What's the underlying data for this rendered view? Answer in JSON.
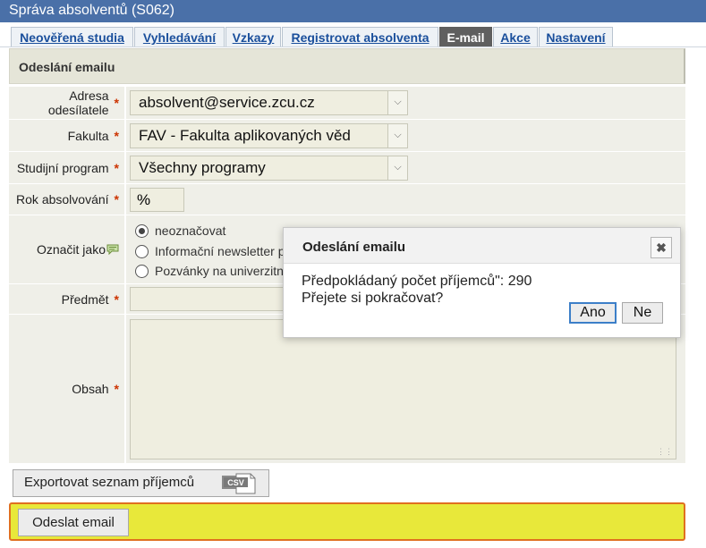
{
  "window": {
    "title": "Správa absolventů (S062)"
  },
  "tabs": [
    {
      "label": "Neověřená studia",
      "active": false
    },
    {
      "label": "Vyhledávání",
      "active": false
    },
    {
      "label": "Vzkazy",
      "active": false
    },
    {
      "label": "Registrovat absolventa",
      "active": false
    },
    {
      "label": "E-mail",
      "active": true
    },
    {
      "label": "Akce",
      "active": false
    },
    {
      "label": "Nastavení",
      "active": false
    }
  ],
  "section": {
    "title": "Odeslání emailu"
  },
  "form": {
    "required_mark": "*",
    "sender": {
      "label": "Adresa odesílatele",
      "value": "absolvent@service.zcu.cz"
    },
    "faculty": {
      "label": "Fakulta",
      "value": "FAV - Fakulta aplikovaných věd"
    },
    "program": {
      "label": "Studijní program",
      "value": "Všechny programy"
    },
    "year": {
      "label": "Rok absolvování",
      "value": "%"
    },
    "mark_as": {
      "label": "Označit jako",
      "options": [
        "neoznačovat",
        "Informační newsletter p",
        "Pozvánky na univerzitn"
      ],
      "selected": 0
    },
    "subject": {
      "label": "Předmět",
      "value": ""
    },
    "body": {
      "label": "Obsah",
      "value": ""
    }
  },
  "export": {
    "label": "Exportovat seznam příjemců",
    "icon_text": "CSV"
  },
  "send": {
    "label": "Odeslat email"
  },
  "dialog": {
    "title": "Odeslání emailu",
    "close_glyph": "✖",
    "line1": "Předpokládaný počet příjemců\": 290",
    "line2": "Přejete si pokračovat?",
    "yes": "Ano",
    "no": "Ne"
  },
  "colors": {
    "title_bar": "#4a70a8",
    "send_bar": "#e8e83a",
    "send_border": "#e07020",
    "required": "#cc3300"
  }
}
